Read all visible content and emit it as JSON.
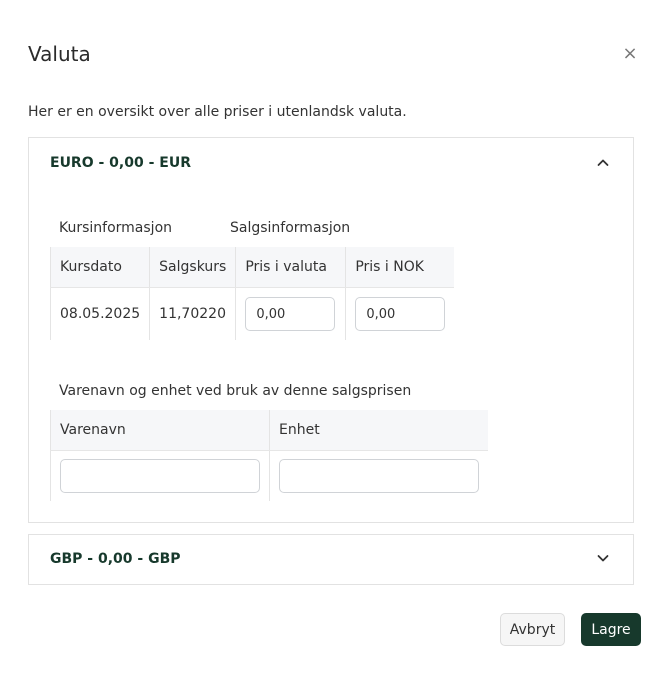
{
  "dialog": {
    "title": "Valuta",
    "close_symbol": "×",
    "intro": "Her er en oversikt over alle priser i utenlandsk valuta."
  },
  "eur_panel": {
    "title": "EURO - 0,00 - EUR",
    "expanded": true,
    "kursinformasjon_label": "Kursinformasjon",
    "salgsinformasjon_label": "Salgsinformasjon",
    "rate_table": {
      "headers": [
        "Kursdato",
        "Salgskurs",
        "Pris i valuta",
        "Pris i NOK"
      ],
      "row": {
        "kursdato": "08.05.2025",
        "salgskurs": "11,70220",
        "pris_i_valuta": "0,00",
        "pris_i_nok": "0,00"
      }
    },
    "varenavn_section_label": "Varenavn og enhet ved bruk av denne salgsprisen",
    "item_table": {
      "headers": [
        "Varenavn",
        "Enhet"
      ],
      "varenavn_value": "",
      "enhet_value": ""
    }
  },
  "gbp_panel": {
    "title": "GBP - 0,00 - GBP",
    "expanded": false
  },
  "footer": {
    "cancel_label": "Avbryt",
    "save_label": "Lagre"
  },
  "colors": {
    "accent": "#17392c",
    "header_bg": "#f6f7f9",
    "border": "#e2e2e2"
  },
  "icons": {
    "close": "close-icon",
    "eur_chevron": "chevron-up-icon",
    "gbp_chevron": "chevron-down-icon"
  }
}
